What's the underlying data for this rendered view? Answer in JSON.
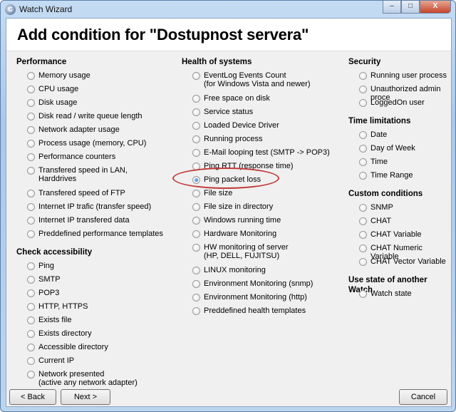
{
  "window": {
    "title": "Watch Wizard",
    "minimize": "–",
    "maximize": "□",
    "close": "X"
  },
  "header": {
    "title": "Add condition for \"Dostupnost servera\""
  },
  "columns": [
    [
      {
        "heading": "Performance",
        "items": [
          "Memory usage",
          "CPU usage",
          "Disk usage",
          "Disk read / write queue length",
          "Network adapter usage",
          "Process usage (memory, CPU)",
          "Performance counters",
          "Transfered speed in LAN,\nHarddrives",
          "Transfered speed of FTP",
          "Internet IP trafic (transfer speed)",
          "Internet IP transfered data",
          "Preddefined performance templates"
        ]
      },
      {
        "heading": "Check accessibility",
        "items": [
          "Ping",
          "SMTP",
          "POP3",
          "HTTP, HTTPS",
          "Exists file",
          "Exists directory",
          "Accessible directory",
          "Current IP",
          "Network presented\n(active any network adapter)"
        ]
      }
    ],
    [
      {
        "heading": "Health of systems",
        "items": [
          "EventLog Events Count\n(for Windows Vista and newer)",
          "Free space on disk",
          "Service status",
          "Loaded Device Driver",
          "Running process",
          "E-Mail looping test (SMTP -> POP3)",
          "Ping RTT (response time)",
          "Ping packet loss",
          "File size",
          "File size in directory",
          "Windows running time",
          "Hardware Monitoring",
          "HW monitoring of server\n(HP, DELL, FUJITSU)",
          "LINUX monitoring",
          "Environment Monitoring (snmp)",
          "Environment Monitoring (http)",
          "Preddefined health templates"
        ]
      }
    ],
    [
      {
        "heading": "Security",
        "items": [
          "Running user process",
          "Unauthorized admin proce",
          "LoggedOn user"
        ]
      },
      {
        "heading": "Time limitations",
        "items": [
          "Date",
          "Day of Week",
          "Time",
          "Time Range"
        ]
      },
      {
        "heading": "Custom conditions",
        "items": [
          "SNMP",
          "CHAT",
          "CHAT Variable",
          "CHAT Numeric Variable",
          "CHAT Vector Variable"
        ]
      },
      {
        "heading": "Use state of another Watch",
        "items": [
          "Watch state"
        ]
      }
    ]
  ],
  "selected": "Ping packet loss",
  "buttons": {
    "back": "< Back",
    "next": "Next >",
    "cancel": "Cancel"
  }
}
